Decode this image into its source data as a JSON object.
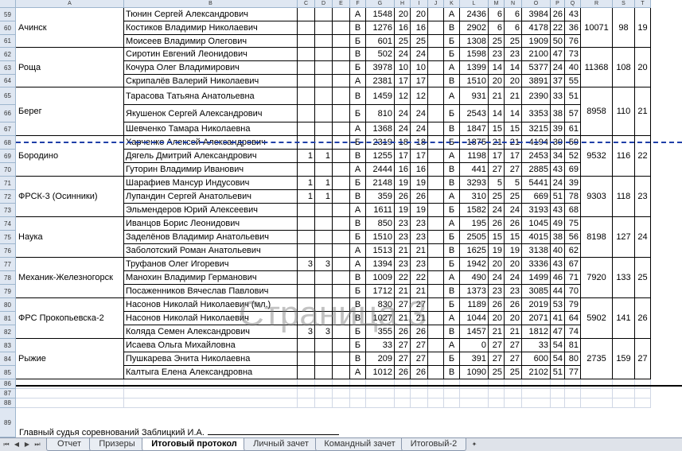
{
  "columns": [
    "A",
    "B",
    "C",
    "D",
    "E",
    "F",
    "G",
    "H",
    "I",
    "J",
    "K",
    "L",
    "M",
    "N",
    "O",
    "P",
    "Q",
    "R",
    "S",
    "T"
  ],
  "teams": [
    {
      "name": "Ачинск",
      "total": "10071",
      "place": "98",
      "rank": "19"
    },
    {
      "name": "Роща",
      "total": "11368",
      "place": "108",
      "rank": "20"
    },
    {
      "name": "Берег",
      "total": "8958",
      "place": "110",
      "rank": "21"
    },
    {
      "name": "Бородино",
      "total": "9532",
      "place": "116",
      "rank": "22"
    },
    {
      "name": "ФРСК-3 (Осинники)",
      "total": "9303",
      "place": "118",
      "rank": "23"
    },
    {
      "name": "Наука",
      "total": "8198",
      "place": "127",
      "rank": "24"
    },
    {
      "name": "Механик-Железногорск",
      "total": "7920",
      "place": "133",
      "rank": "25"
    },
    {
      "name": "ФРС Прокопьевска-2",
      "total": "5902",
      "place": "141",
      "rank": "26"
    },
    {
      "name": "Рыжие",
      "total": "2735",
      "place": "159",
      "rank": "27"
    }
  ],
  "rows": [
    {
      "num": "59",
      "name": "Тюнин Сергей Александрович",
      "c": "",
      "d": "",
      "f": "А",
      "g": "1548",
      "h": "20",
      "i": "20",
      "k": "А",
      "l": "2436",
      "m": "6",
      "n": "6",
      "o": "3984",
      "p": "26",
      "q": "43"
    },
    {
      "num": "60",
      "name": "Костиков Владимир Николаевич",
      "c": "",
      "d": "",
      "f": "В",
      "g": "1276",
      "h": "16",
      "i": "16",
      "k": "В",
      "l": "2902",
      "m": "6",
      "n": "6",
      "o": "4178",
      "p": "22",
      "q": "36"
    },
    {
      "num": "61",
      "name": "Моисеев Владимир Олегович",
      "c": "",
      "d": "",
      "f": "Б",
      "g": "601",
      "h": "25",
      "i": "25",
      "k": "Б",
      "l": "1308",
      "m": "25",
      "n": "25",
      "o": "1909",
      "p": "50",
      "q": "76"
    },
    {
      "num": "62",
      "name": "Сиротин Евгений Леонидович",
      "c": "",
      "d": "",
      "f": "В",
      "g": "502",
      "h": "24",
      "i": "24",
      "k": "Б",
      "l": "1598",
      "m": "23",
      "n": "23",
      "o": "2100",
      "p": "47",
      "q": "73"
    },
    {
      "num": "63",
      "name": "Кочура Олег Владимирович",
      "c": "",
      "d": "",
      "f": "Б",
      "g": "3978",
      "h": "10",
      "i": "10",
      "k": "А",
      "l": "1399",
      "m": "14",
      "n": "14",
      "o": "5377",
      "p": "24",
      "q": "40"
    },
    {
      "num": "64",
      "name": "Скрипалёв Валерий Николаевич",
      "c": "",
      "d": "",
      "f": "А",
      "g": "2381",
      "h": "17",
      "i": "17",
      "k": "В",
      "l": "1510",
      "m": "20",
      "n": "20",
      "o": "3891",
      "p": "37",
      "q": "55"
    },
    {
      "num": "65",
      "name": "Тарасова Татьяна Анатольевна",
      "c": "",
      "d": "",
      "f": "В",
      "g": "1459",
      "h": "12",
      "i": "12",
      "k": "А",
      "l": "931",
      "m": "21",
      "n": "21",
      "o": "2390",
      "p": "33",
      "q": "51"
    },
    {
      "num": "66",
      "name": "Якушенок Сергей Александрович",
      "c": "",
      "d": "",
      "f": "Б",
      "g": "810",
      "h": "24",
      "i": "24",
      "k": "Б",
      "l": "2543",
      "m": "14",
      "n": "14",
      "o": "3353",
      "p": "38",
      "q": "57"
    },
    {
      "num": "67",
      "name": "Шевченко Тамара Николаевна",
      "c": "",
      "d": "",
      "f": "А",
      "g": "1368",
      "h": "24",
      "i": "24",
      "k": "В",
      "l": "1847",
      "m": "15",
      "n": "15",
      "o": "3215",
      "p": "39",
      "q": "61"
    },
    {
      "num": "68",
      "name": "Харченко Алексей Александрович",
      "c": "",
      "d": "",
      "f": "Б",
      "g": "2319",
      "h": "18",
      "i": "18",
      "k": "Б",
      "l": "1875",
      "m": "21",
      "n": "21",
      "o": "4194",
      "p": "39",
      "q": "59"
    },
    {
      "num": "69",
      "name": "Дягель Дмитрий Александрович",
      "c": "1",
      "d": "1",
      "f": "В",
      "g": "1255",
      "h": "17",
      "i": "17",
      "k": "А",
      "l": "1198",
      "m": "17",
      "n": "17",
      "o": "2453",
      "p": "34",
      "q": "52"
    },
    {
      "num": "70",
      "name": "Гуторин Владимир Иванович",
      "c": "",
      "d": "",
      "f": "А",
      "g": "2444",
      "h": "16",
      "i": "16",
      "k": "В",
      "l": "441",
      "m": "27",
      "n": "27",
      "o": "2885",
      "p": "43",
      "q": "69"
    },
    {
      "num": "71",
      "name": "Шарафиев Мансур Индусович",
      "c": "1",
      "d": "1",
      "f": "Б",
      "g": "2148",
      "h": "19",
      "i": "19",
      "k": "В",
      "l": "3293",
      "m": "5",
      "n": "5",
      "o": "5441",
      "p": "24",
      "q": "39"
    },
    {
      "num": "72",
      "name": "Лупандин Сергей Анатольевич",
      "c": "1",
      "d": "1",
      "f": "В",
      "g": "359",
      "h": "26",
      "i": "26",
      "k": "А",
      "l": "310",
      "m": "25",
      "n": "25",
      "o": "669",
      "p": "51",
      "q": "78"
    },
    {
      "num": "73",
      "name": "Эльмендеров Юрий Алексеевич",
      "c": "",
      "d": "",
      "f": "А",
      "g": "1611",
      "h": "19",
      "i": "19",
      "k": "Б",
      "l": "1582",
      "m": "24",
      "n": "24",
      "o": "3193",
      "p": "43",
      "q": "68"
    },
    {
      "num": "74",
      "name": "Иванцов Борис Леонидович",
      "c": "",
      "d": "",
      "f": "В",
      "g": "850",
      "h": "23",
      "i": "23",
      "k": "А",
      "l": "195",
      "m": "26",
      "n": "26",
      "o": "1045",
      "p": "49",
      "q": "75"
    },
    {
      "num": "75",
      "name": "Заделёнов Владимир Анатольевич",
      "c": "",
      "d": "",
      "f": "Б",
      "g": "1510",
      "h": "23",
      "i": "23",
      "k": "Б",
      "l": "2505",
      "m": "15",
      "n": "15",
      "o": "4015",
      "p": "38",
      "q": "56"
    },
    {
      "num": "76",
      "name": "Заболотский Роман Анатольевич",
      "c": "",
      "d": "",
      "f": "А",
      "g": "1513",
      "h": "21",
      "i": "21",
      "k": "В",
      "l": "1625",
      "m": "19",
      "n": "19",
      "o": "3138",
      "p": "40",
      "q": "62"
    },
    {
      "num": "77",
      "name": "Труфанов Олег Игоревич",
      "c": "3",
      "d": "3",
      "f": "А",
      "g": "1394",
      "h": "23",
      "i": "23",
      "k": "Б",
      "l": "1942",
      "m": "20",
      "n": "20",
      "o": "3336",
      "p": "43",
      "q": "67"
    },
    {
      "num": "78",
      "name": "Манохин Владимир Германович",
      "c": "",
      "d": "",
      "f": "В",
      "g": "1009",
      "h": "22",
      "i": "22",
      "k": "А",
      "l": "490",
      "m": "24",
      "n": "24",
      "o": "1499",
      "p": "46",
      "q": "71"
    },
    {
      "num": "79",
      "name": "Посаженников Вячеслав Павлович",
      "c": "",
      "d": "",
      "f": "Б",
      "g": "1712",
      "h": "21",
      "i": "21",
      "k": "В",
      "l": "1373",
      "m": "23",
      "n": "23",
      "o": "3085",
      "p": "44",
      "q": "70"
    },
    {
      "num": "80",
      "name": "Насонов Николай Николаевич (мл.)",
      "c": "",
      "d": "",
      "f": "В",
      "g": "830",
      "h": "27",
      "i": "27",
      "k": "Б",
      "l": "1189",
      "m": "26",
      "n": "26",
      "o": "2019",
      "p": "53",
      "q": "79"
    },
    {
      "num": "81",
      "name": "Насонов Николай Николаевич",
      "c": "",
      "d": "",
      "f": "В",
      "g": "1027",
      "h": "21",
      "i": "21",
      "k": "А",
      "l": "1044",
      "m": "20",
      "n": "20",
      "o": "2071",
      "p": "41",
      "q": "64"
    },
    {
      "num": "82",
      "name": "Коляда Семен Александрович",
      "c": "3",
      "d": "3",
      "f": "Б",
      "g": "355",
      "h": "26",
      "i": "26",
      "k": "В",
      "l": "1457",
      "m": "21",
      "n": "21",
      "o": "1812",
      "p": "47",
      "q": "74"
    },
    {
      "num": "83",
      "name": "Исаева Ольга Михайловна",
      "c": "",
      "d": "",
      "f": "Б",
      "g": "33",
      "h": "27",
      "i": "27",
      "k": "А",
      "l": "0",
      "m": "27",
      "n": "27",
      "o": "33",
      "p": "54",
      "q": "81"
    },
    {
      "num": "84",
      "name": "Пушкарева Энита Николаевна",
      "c": "",
      "d": "",
      "f": "В",
      "g": "209",
      "h": "27",
      "i": "27",
      "k": "Б",
      "l": "391",
      "m": "27",
      "n": "27",
      "o": "600",
      "p": "54",
      "q": "80"
    },
    {
      "num": "85",
      "name": "Калтыга Елена Александровна",
      "c": "",
      "d": "",
      "f": "А",
      "g": "1012",
      "h": "26",
      "i": "26",
      "k": "В",
      "l": "1090",
      "m": "25",
      "n": "25",
      "o": "2102",
      "p": "51",
      "q": "77"
    }
  ],
  "empty_rows": [
    "86",
    "87",
    "88"
  ],
  "footer_row_num": "89",
  "judge_text": "Главный судья соревнований Заблицкий И.А.",
  "watermark": "Страница 3",
  "sheet_tabs": [
    "Отчет",
    "Призеры",
    "Итоговый протокол",
    "Личный зачет",
    "Командный зачет",
    "Итоговый-2"
  ],
  "active_tab": "Итоговый протокол"
}
